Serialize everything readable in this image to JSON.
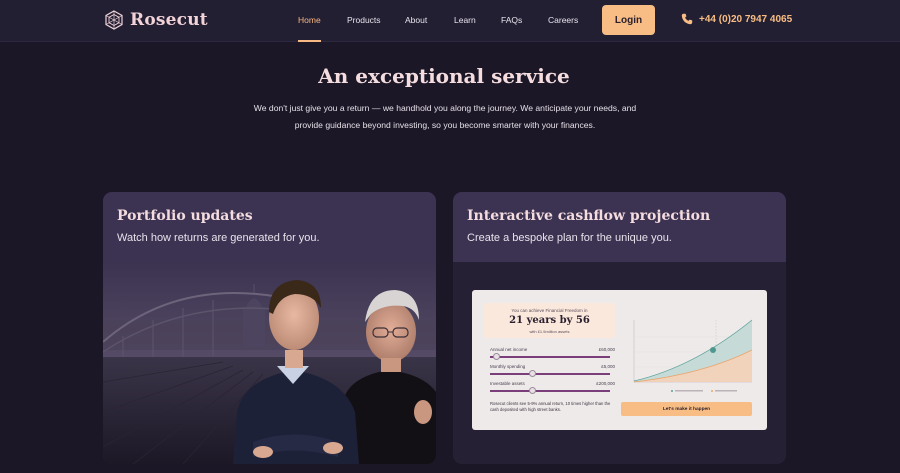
{
  "brand": {
    "name": "Rosecut",
    "accent": "#f7bd84",
    "background": "#1b1726"
  },
  "nav": {
    "links": [
      "Home",
      "Products",
      "About",
      "Learn",
      "FAQs",
      "Careers"
    ],
    "active": "Home",
    "login_label": "Login",
    "phone": "+44 (0)20 7947 4065"
  },
  "hero": {
    "title": "An exceptional service",
    "subtitle": "We don't just give you a return — we handhold you along the journey. We anticipate your needs, and provide guidance beyond investing, so you become smarter with your finances."
  },
  "cards": {
    "portfolio": {
      "title": "Portfolio updates",
      "subtitle": "Watch how returns are generated for you."
    },
    "cashflow": {
      "title": "Interactive cashflow projection",
      "subtitle": "Create a bespoke plan for the unique you.",
      "projection": {
        "headline_top": "You can achieve Financial Freedom in",
        "headline_big": "21 years by 56",
        "headline_small": "with £1.5million assets",
        "sliders": [
          {
            "label": "Annual net income",
            "value": "£60,000",
            "fraction": 0.05
          },
          {
            "label": "Monthly spending",
            "value": "£5,000",
            "fraction": 0.35
          },
          {
            "label": "Investable assets",
            "value": "£200,000",
            "fraction": 0.35
          }
        ],
        "note": "Rosecut clients see 5-9% annual return, 10 times higher than the cash deposited with high street banks.",
        "cta": "Let's make it happen"
      }
    }
  }
}
